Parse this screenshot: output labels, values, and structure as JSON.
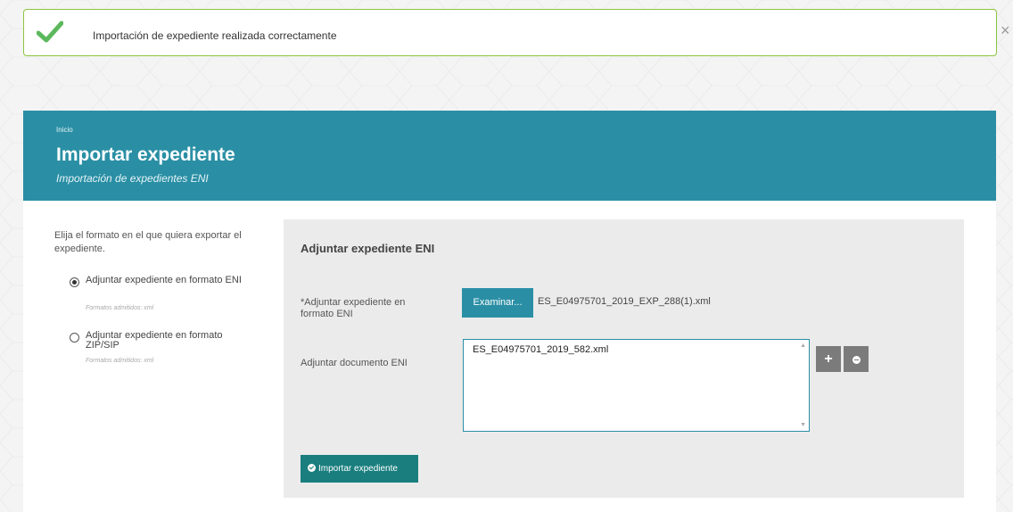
{
  "alert": {
    "message": "Importación de expediente realizada correctamente",
    "close_symbol": "×",
    "icon": "check-icon",
    "color": "#8cc63f"
  },
  "header": {
    "breadcrumb": "Inicio",
    "title": "Importar expediente",
    "subtitle": "Importación de expedientes ENI",
    "background": "#2a8fa5"
  },
  "left_panel": {
    "intro": "Elija el formato en el que quiera exportar el expediente.",
    "options": [
      {
        "label": "Adjuntar expediente en formato ENI",
        "hint": "Formatos admitidos: xml",
        "selected": true
      },
      {
        "label": "Adjuntar expediente en formato ZIP/SIP",
        "hint": "Formatos admitidos: xml",
        "selected": false
      }
    ]
  },
  "form": {
    "title": "Adjuntar expediente ENI",
    "expediente_label": "*Adjuntar expediente en formato ENI",
    "browse_label": "Examinar...",
    "selected_file": "ES_E04975701_2019_EXP_288(1).xml",
    "documento_label": "Adjuntar documento ENI",
    "documento_value": "ES_E04975701_2019_582.xml",
    "add_symbol": "+",
    "submit_label": "Importar expediente",
    "submit_color": "#1a7e7e"
  }
}
